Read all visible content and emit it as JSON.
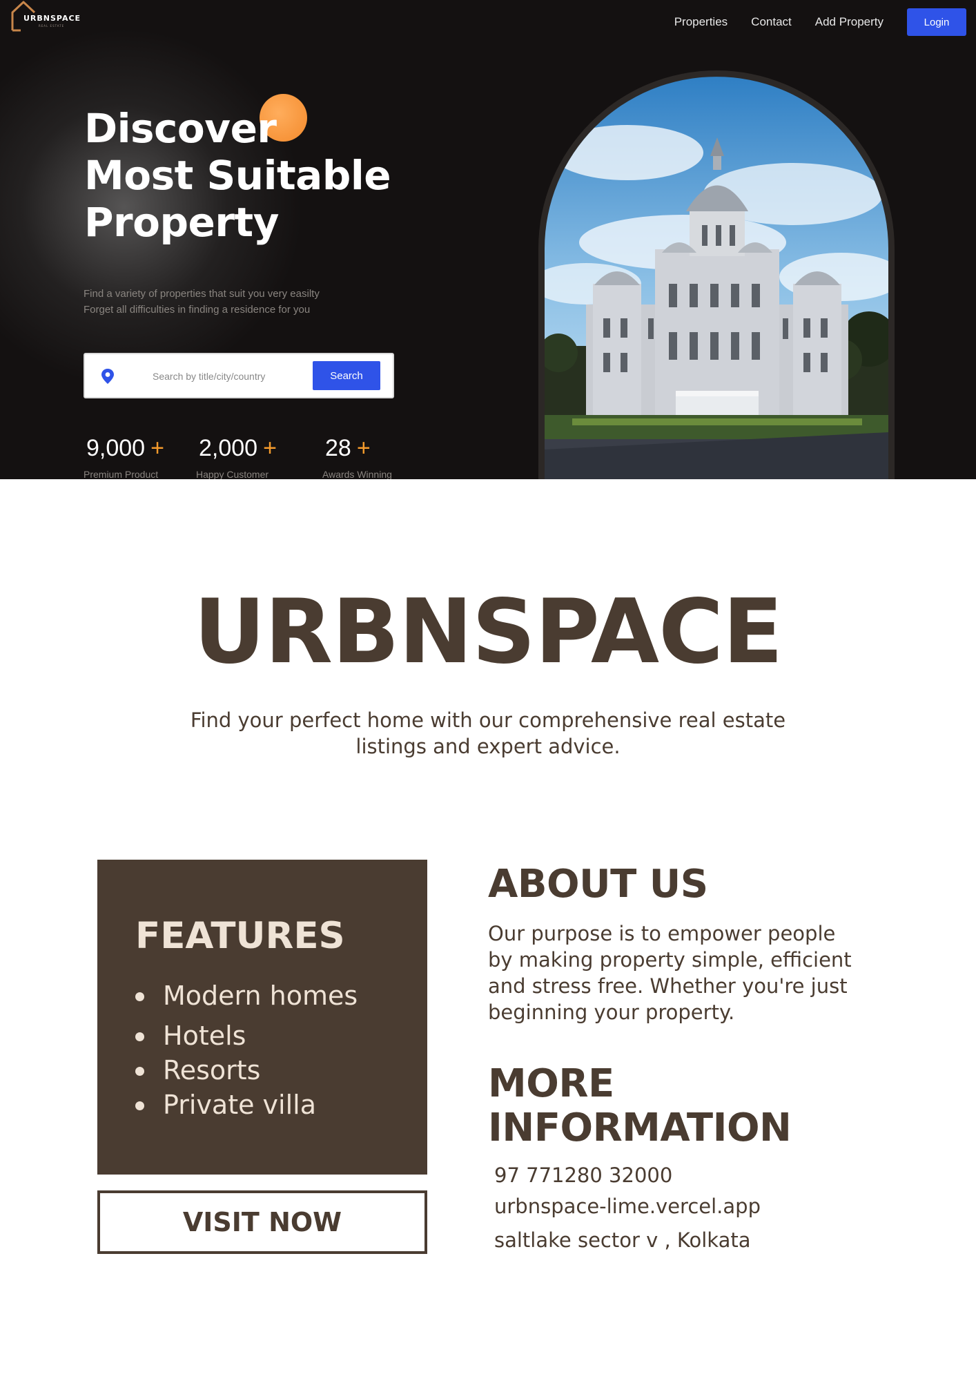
{
  "brand": {
    "logo_text": "URBNSPACE",
    "logo_subtext": "REAL ESTATE"
  },
  "nav": {
    "links": [
      "Properties",
      "Contact",
      "Add Property"
    ],
    "login_label": "Login",
    "accent": "#2f53e8"
  },
  "hero": {
    "title_lines": [
      "Discover",
      "Most Suitable",
      "Property"
    ],
    "description_lines": [
      "Find a variety of properties that suit you very easilty",
      "Forget all difficulties in finding a residence for you"
    ],
    "search": {
      "placeholder": "Search by title/city/country",
      "button_label": "Search",
      "icon": "location-pin-icon"
    },
    "stats": [
      {
        "value": "9,000",
        "plus": "+",
        "label": "Premium Product"
      },
      {
        "value": "2,000",
        "plus": "+",
        "label": "Happy Customer"
      },
      {
        "value": "28",
        "plus": "+",
        "label": "Awards Winning"
      }
    ],
    "accent_orange": "#f39a2c",
    "background": "#141111"
  },
  "intro": {
    "brand_name": "URBNSPACE",
    "tagline_lines": [
      "Find your perfect home with our comprehensive real estate",
      "listings and expert advice."
    ]
  },
  "features": {
    "title": "FEATURES",
    "items": [
      "Modern homes",
      "Hotels",
      "Resorts",
      "Private villa"
    ],
    "button_label": "VISIT NOW",
    "panel_color": "#4a3c31"
  },
  "about": {
    "title": "ABOUT US",
    "text_lines": [
      "Our purpose is to empower people",
      "by making property simple, efficient",
      "and stress free. Whether you're just",
      "beginning your property."
    ]
  },
  "more_info": {
    "title_lines": [
      "MORE",
      "INFORMATION"
    ],
    "phone": "97 771280 32000",
    "website": "urbnspace-lime.vercel.app",
    "address": "saltlake sector v , Kolkata"
  }
}
